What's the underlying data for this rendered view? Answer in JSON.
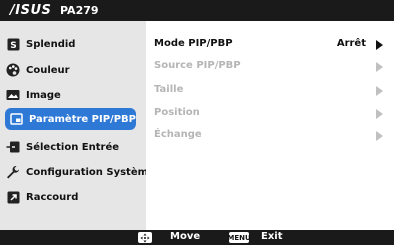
{
  "header": {
    "brand": "/ISUS",
    "model": "PA279"
  },
  "sidebar": {
    "items": [
      {
        "label": "Splendid",
        "icon": "splendid-icon"
      },
      {
        "label": "Couleur",
        "icon": "palette-icon"
      },
      {
        "label": "Image",
        "icon": "image-icon"
      },
      {
        "label": "Paramètre PIP/PBP",
        "icon": "pip-icon",
        "active": true
      },
      {
        "label": "Sélection Entrée",
        "icon": "input-icon"
      },
      {
        "label": "Configuration Système",
        "icon": "wrench-icon"
      },
      {
        "label": "Raccourd",
        "icon": "shortcut-icon"
      }
    ]
  },
  "main": {
    "options": [
      {
        "label": "Mode PIP/PBP",
        "value": "Arrêt",
        "enabled": true
      },
      {
        "label": "Source PIP/PBP",
        "enabled": false
      },
      {
        "label": "Taille",
        "enabled": false
      },
      {
        "label": "Position",
        "enabled": false
      },
      {
        "label": "Échange",
        "enabled": false
      }
    ]
  },
  "footer": {
    "move_icon": "dpad-icon",
    "move_label": "Move",
    "menu_icon_text": "MENU",
    "exit_label": "Exit"
  },
  "colors": {
    "header_bg": "#1a1a1a",
    "sidebar_bg": "#e6e6e6",
    "accent": "#2e78d6",
    "disabled_text": "#b5b5b5"
  }
}
